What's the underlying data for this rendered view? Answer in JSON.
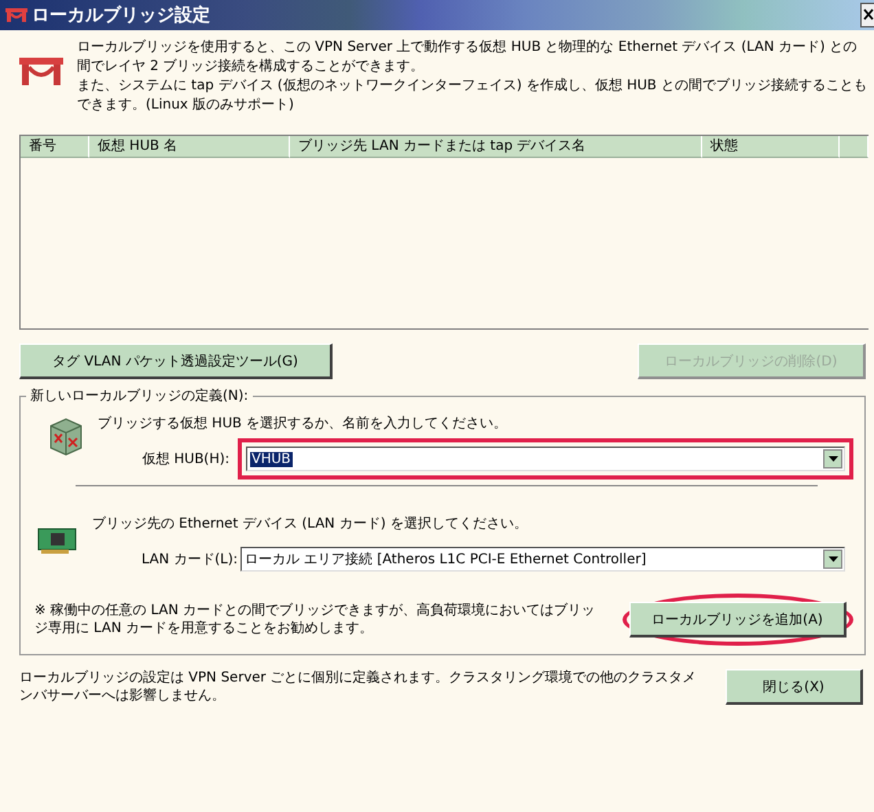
{
  "window": {
    "title": "ローカルブリッジ設定"
  },
  "intro": [
    "ローカルブリッジを使用すると、この VPN Server 上で動作する仮想 HUB と物理的な Ethernet デバイス (LAN カード) との間でレイヤ 2 ブリッジ接続を構成することができます。",
    "また、システムに tap デバイス (仮想のネットワークインターフェイス) を作成し、仮想 HUB との間でブリッジ接続することもできます。(Linux 版のみサポート)"
  ],
  "table": {
    "columns": [
      "番号",
      "仮想 HUB 名",
      "ブリッジ先 LAN カードまたは tap デバイス名",
      "状態"
    ]
  },
  "toolbar": [
    {
      "label": "タグ VLAN パケット透過設定ツール(G)",
      "disabled": false
    },
    {
      "label": "ローカルブリッジの削除(D)",
      "disabled": true
    }
  ],
  "group": {
    "title": "新しいローカルブリッジの定義(N):",
    "hub": {
      "prompt": "ブリッジする仮想 HUB を選択するか、名前を入力してください。",
      "label": "仮想 HUB(H):",
      "value": "VHUB",
      "highlighted": true
    },
    "lan": {
      "prompt": "ブリッジ先の Ethernet デバイス (LAN カード) を選択してください。",
      "label": "LAN カード(L):",
      "value": "ローカル エリア接続 [Atheros L1C PCI-E Ethernet Controller]",
      "highlighted": false
    },
    "note": "※ 稼働中の任意の LAN カードとの間でブリッジできますが、高負荷環境においてはブリッジ専用に LAN カードを用意することをお勧めします。",
    "add_button": {
      "label": "ローカルブリッジを追加(A)",
      "highlighted": true
    }
  },
  "footer": {
    "note": "ローカルブリッジの設定は VPN Server ごとに個別に定義されます。クラスタリング環境での他のクラスタメンバサーバーへは影響しません。",
    "close_button": "閉じる(X)"
  }
}
